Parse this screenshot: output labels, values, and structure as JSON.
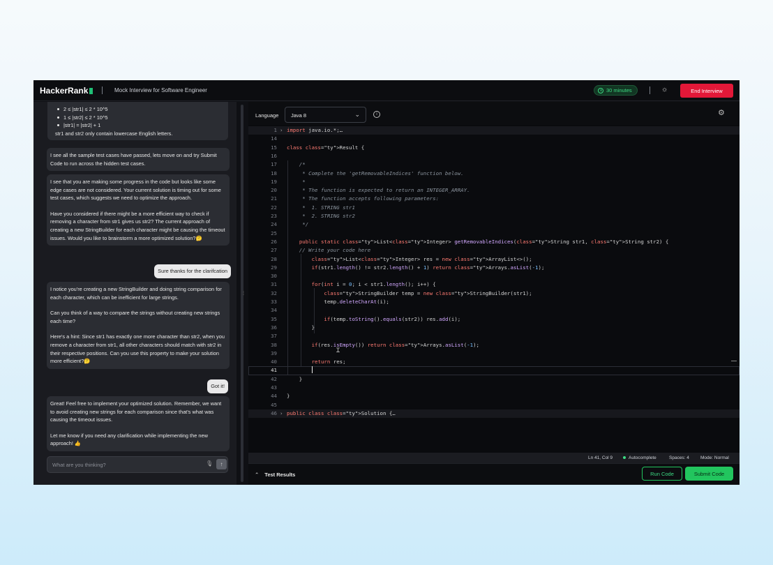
{
  "header": {
    "logo_text": "HackerRank",
    "title": "Mock Interview for Software Engineer",
    "timer": "30 minutes",
    "end_button": "End Interview"
  },
  "chat": {
    "constraints": [
      "2 ≤ |str1| ≤ 2 * 10^5",
      "1 ≤ |str2| ≤ 2 * 10^5",
      "|str1| = |str2| + 1",
      "str1 and str2 only contain lowercase English letters."
    ],
    "messages": [
      {
        "role": "ai",
        "paragraphs": [
          "I see all the sample test cases have passed, lets move on and try Submit Code to run across the hidden test cases."
        ]
      },
      {
        "role": "ai",
        "paragraphs": [
          "I see that you are making some progress in the code but looks like some edge cases are not considered. Your current solution is timing out for some test cases, which suggests we need to optimize the approach.",
          "Have you considered if there might be a more efficient way to check if removing a character from str1 gives us str2? The current approach of creating a new StringBuilder for each character might be causing the timeout issues. Would you like to brainstorm a more optimized solution?🤔"
        ]
      },
      {
        "role": "user",
        "text": "Sure thanks for the clarifcation"
      },
      {
        "role": "ai",
        "paragraphs": [
          "I notice you're creating a new StringBuilder and doing string comparison for each character, which can be inefficient for large strings.",
          "Can you think of a way to compare the strings without creating new strings each time?",
          "Here's a hint: Since str1 has exactly one more character than str2, when you remove a character from str1, all other characters should match with str2 in their respective positions. Can you use this property to make your solution more efficient?🤔"
        ]
      },
      {
        "role": "user",
        "text": "Got it!"
      },
      {
        "role": "ai",
        "paragraphs": [
          "Great! Feel free to implement your optimized solution. Remember, we want to avoid creating new strings for each comparison since that's what was causing the timeout issues.",
          "Let me know if you need any clarification while implementing the new approach! 👍"
        ]
      }
    ],
    "input_placeholder": "What are you thinking?"
  },
  "editor": {
    "language_label": "Language",
    "language": "Java 8",
    "lines": [
      {
        "n": "1",
        "code": "import java.io.*;…"
      },
      {
        "n": "14",
        "code": ""
      },
      {
        "n": "15",
        "code": "class Result {"
      },
      {
        "n": "16",
        "code": ""
      },
      {
        "n": "17",
        "code": "    /*"
      },
      {
        "n": "18",
        "code": "     * Complete the 'getRemovableIndices' function below."
      },
      {
        "n": "19",
        "code": "     *"
      },
      {
        "n": "20",
        "code": "     * The function is expected to return an INTEGER_ARRAY."
      },
      {
        "n": "21",
        "code": "     * The function accepts following parameters:"
      },
      {
        "n": "22",
        "code": "     *  1. STRING str1"
      },
      {
        "n": "23",
        "code": "     *  2. STRING str2"
      },
      {
        "n": "24",
        "code": "     */"
      },
      {
        "n": "25",
        "code": ""
      },
      {
        "n": "26",
        "code": "    public static List<Integer> getRemovableIndices(String str1, String str2) {"
      },
      {
        "n": "27",
        "code": "    // Write your code here"
      },
      {
        "n": "28",
        "code": "        List<Integer> res = new ArrayList<>();"
      },
      {
        "n": "29",
        "code": "        if(str1.length() != str2.length() + 1) return Arrays.asList(-1);"
      },
      {
        "n": "30",
        "code": ""
      },
      {
        "n": "31",
        "code": "        for(int i = 0; i < str1.length(); i++) {"
      },
      {
        "n": "32",
        "code": "            StringBuilder temp = new StringBuilder(str1);"
      },
      {
        "n": "33",
        "code": "            temp.deleteCharAt(i);"
      },
      {
        "n": "34",
        "code": ""
      },
      {
        "n": "35",
        "code": "            if(temp.toString().equals(str2)) res.add(i);"
      },
      {
        "n": "36",
        "code": "        }"
      },
      {
        "n": "37",
        "code": ""
      },
      {
        "n": "38",
        "code": "        if(res.isEmpty()) return Arrays.asList(-1);"
      },
      {
        "n": "39",
        "code": ""
      },
      {
        "n": "40",
        "code": "        return res;"
      },
      {
        "n": "41",
        "code": "        "
      },
      {
        "n": "42",
        "code": "    }"
      },
      {
        "n": "43",
        "code": ""
      },
      {
        "n": "44",
        "code": "}"
      },
      {
        "n": "45",
        "code": ""
      },
      {
        "n": "46",
        "code": "public class Solution {…"
      }
    ],
    "status": {
      "position": "Ln 41, Col 9",
      "autocomplete": "Autocomplete",
      "spaces": "Spaces: 4",
      "mode": "Mode: Normal"
    }
  },
  "bottom": {
    "test_results": "Test Results",
    "run_button": "Run Code",
    "submit_button": "Submit Code"
  },
  "colors": {
    "accent_green": "#22c55e",
    "danger_red": "#e21838",
    "background": "#0f1014"
  },
  "icons": [
    "timer-icon",
    "sun-icon",
    "info-icon",
    "settings-gear-icon",
    "microphone-icon",
    "send-arrow-icon",
    "chevron-down-icon",
    "chevron-up-icon",
    "fold-chevron-icon"
  ]
}
